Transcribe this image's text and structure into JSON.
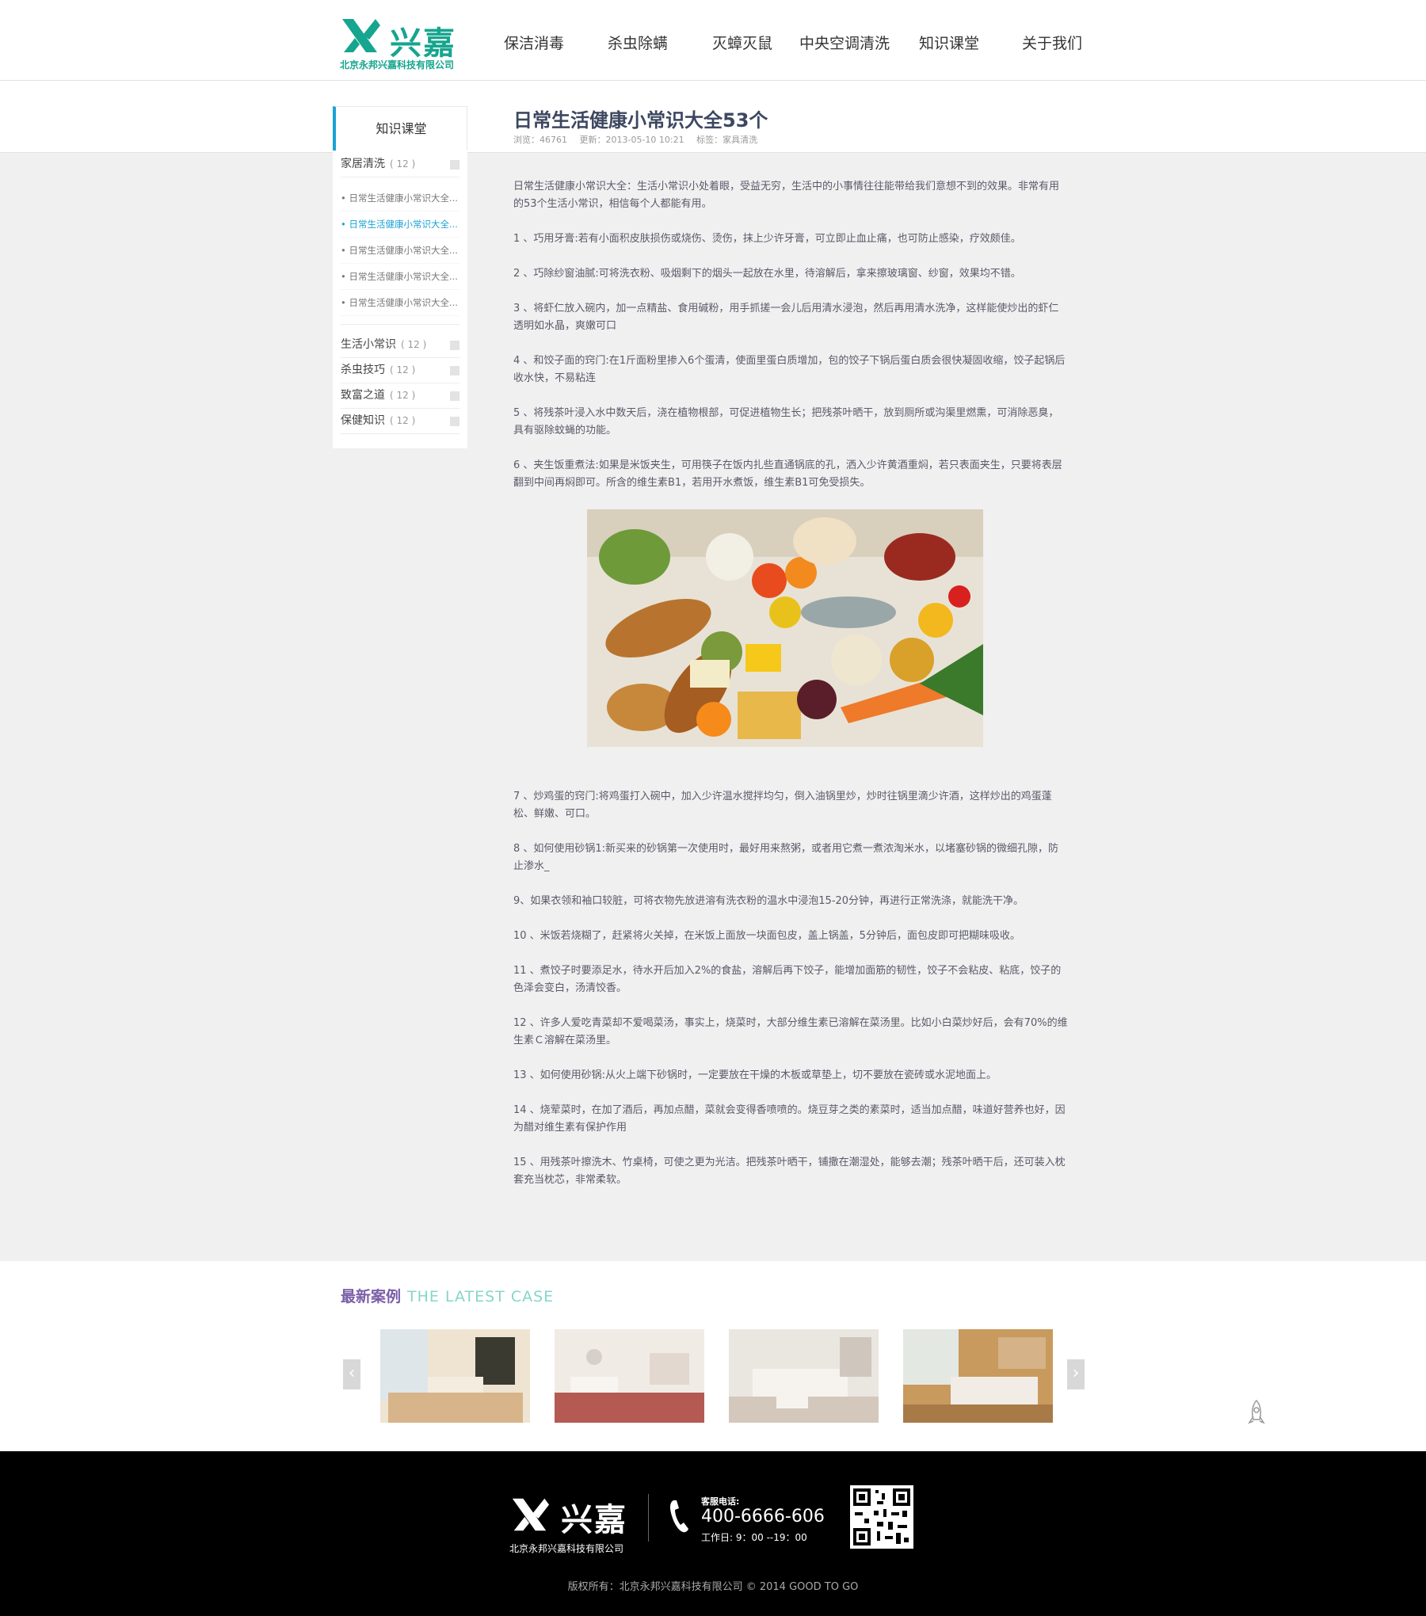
{
  "header": {
    "logo_text": "兴嘉",
    "logo_subtitle": "北京永邦兴嘉科技有限公司",
    "nav": [
      "保洁消毒",
      "杀虫除螨",
      "灭蟑灭鼠",
      "中央空调清洗",
      "知识课堂",
      "关于我们"
    ]
  },
  "sidebar": {
    "title": "知识课堂",
    "open_category": {
      "label": "家居清洗",
      "count": "( 12 )"
    },
    "sub_items": [
      "• 日常生活健康小常识大全...",
      "• 日常生活健康小常识大全...",
      "• 日常生活健康小常识大全...",
      "• 日常生活健康小常识大全...",
      "• 日常生活健康小常识大全..."
    ],
    "active_sub_index": 1,
    "categories": [
      {
        "label": "生活小常识",
        "count": "( 12 )"
      },
      {
        "label": "杀虫技巧",
        "count": "( 12 )"
      },
      {
        "label": "致富之道",
        "count": "( 12 )"
      },
      {
        "label": "保健知识",
        "count": "( 12 )"
      }
    ]
  },
  "article": {
    "title": "日常生活健康小常识大全53个",
    "views": "浏览：46761",
    "updated": "更新：2013-05-10 10:21",
    "tags": "标签：家具清洗",
    "intro": "日常生活健康小常识大全：生活小常识小处着眼，受益无穷，生活中的小事情往往能带给我们意想不到的效果。非常有用的53个生活小常识，相信每个人都能有用。",
    "paragraphs_before_image": [
      "1 、巧用牙膏:若有小面积皮肤损伤或烧伤、烫伤，抹上少许牙膏，可立即止血止痛，也可防止感染，疗效颇佳。",
      "2 、巧除纱窗油腻:可将洗衣粉、吸烟剩下的烟头一起放在水里，待溶解后，拿来擦玻璃窗、纱窗，效果均不错。",
      "3 、将虾仁放入碗内，加一点精盐、食用碱粉，用手抓搓一会儿后用清水浸泡，然后再用清水洗净，这样能使炒出的虾仁透明如水晶，爽嫩可口",
      "4 、和饺子面的窍门:在1斤面粉里掺入6个蛋清，使面里蛋白质增加，包的饺子下锅后蛋白质会很快凝固收缩，饺子起锅后收水快，不易粘连",
      "5 、将残茶叶浸入水中数天后，浇在植物根部，可促进植物生长；把残茶叶晒干，放到厕所或沟渠里燃熏，可消除恶臭，具有驱除蚊蝇的功能。",
      "6 、夹生饭重煮法:如果是米饭夹生，可用筷子在饭内扎些直通锅底的孔，洒入少许黄酒重焖，若只表面夹生，只要将表层翻到中间再焖即可。所含的维生素B1，若用开水煮饭，维生素B1可免受损失。"
    ],
    "paragraphs_after_image": [
      "7 、炒鸡蛋的窍门:将鸡蛋打入碗中，加入少许温水搅拌均匀，倒入油锅里炒，炒时往锅里滴少许酒，这样炒出的鸡蛋蓬松、鲜嫩、可口。",
      "8 、如何使用砂锅1:新买来的砂锅第一次使用时，最好用来熬粥，或者用它煮一煮浓淘米水，以堵塞砂锅的微细孔隙，防止渗水_",
      "9、如果衣领和袖口较脏，可将衣物先放进溶有洗衣粉的温水中浸泡15-20分钟，再进行正常洗涤，就能洗干净。",
      "10 、米饭若烧糊了，赶紧将火关掉，在米饭上面放一块面包皮，盖上锅盖，5分钟后，面包皮即可把糊味吸收。",
      "11 、煮饺子时要添足水，待水开后加入2%的食盐，溶解后再下饺子，能增加面筋的韧性，饺子不会粘皮、粘底，饺子的色泽会变白，汤清饺香。",
      "12 、许多人爱吃青菜却不爱喝菜汤，事实上，烧菜时，大部分维生素已溶解在菜汤里。比如小白菜炒好后，会有70%的维生素Ｃ溶解在菜汤里。",
      "13 、如何使用砂锅:从火上端下砂锅时，一定要放在干燥的木板或草垫上，切不要放在瓷砖或水泥地面上。",
      "14 、烧荤菜时，在加了酒后，再加点醋，菜就会变得香喷喷的。烧豆芽之类的素菜时，适当加点醋，味道好营养也好，因为醋对维生素有保护作用",
      "15 、用残茶叶擦洗木、竹桌椅，可使之更为光洁。把残茶叶晒干，铺撒在潮湿处，能够去潮；残茶叶晒干后，还可装入枕套充当枕芯，非常柔软。"
    ]
  },
  "latest_case": {
    "title_cn": "最新案例",
    "title_en": "THE LATEST CASE",
    "prev_icon": "chevron-left-icon",
    "next_icon": "chevron-right-icon"
  },
  "footer": {
    "logo_text": "兴嘉",
    "logo_subtitle": "北京永邦兴嘉科技有限公司",
    "service_label": "客服电话:",
    "phone": "400-6666-606",
    "hours": "工作日:  9：00 --19：00",
    "copyright": "版权所有：北京永邦兴嘉科技有限公司 © 2014 GOOD TO GO"
  },
  "colors": {
    "brand_green": "#16a58e",
    "accent_blue": "#1aa3d4",
    "case_title_purple": "#7a5ea8",
    "case_title_teal": "#86d6c8"
  }
}
